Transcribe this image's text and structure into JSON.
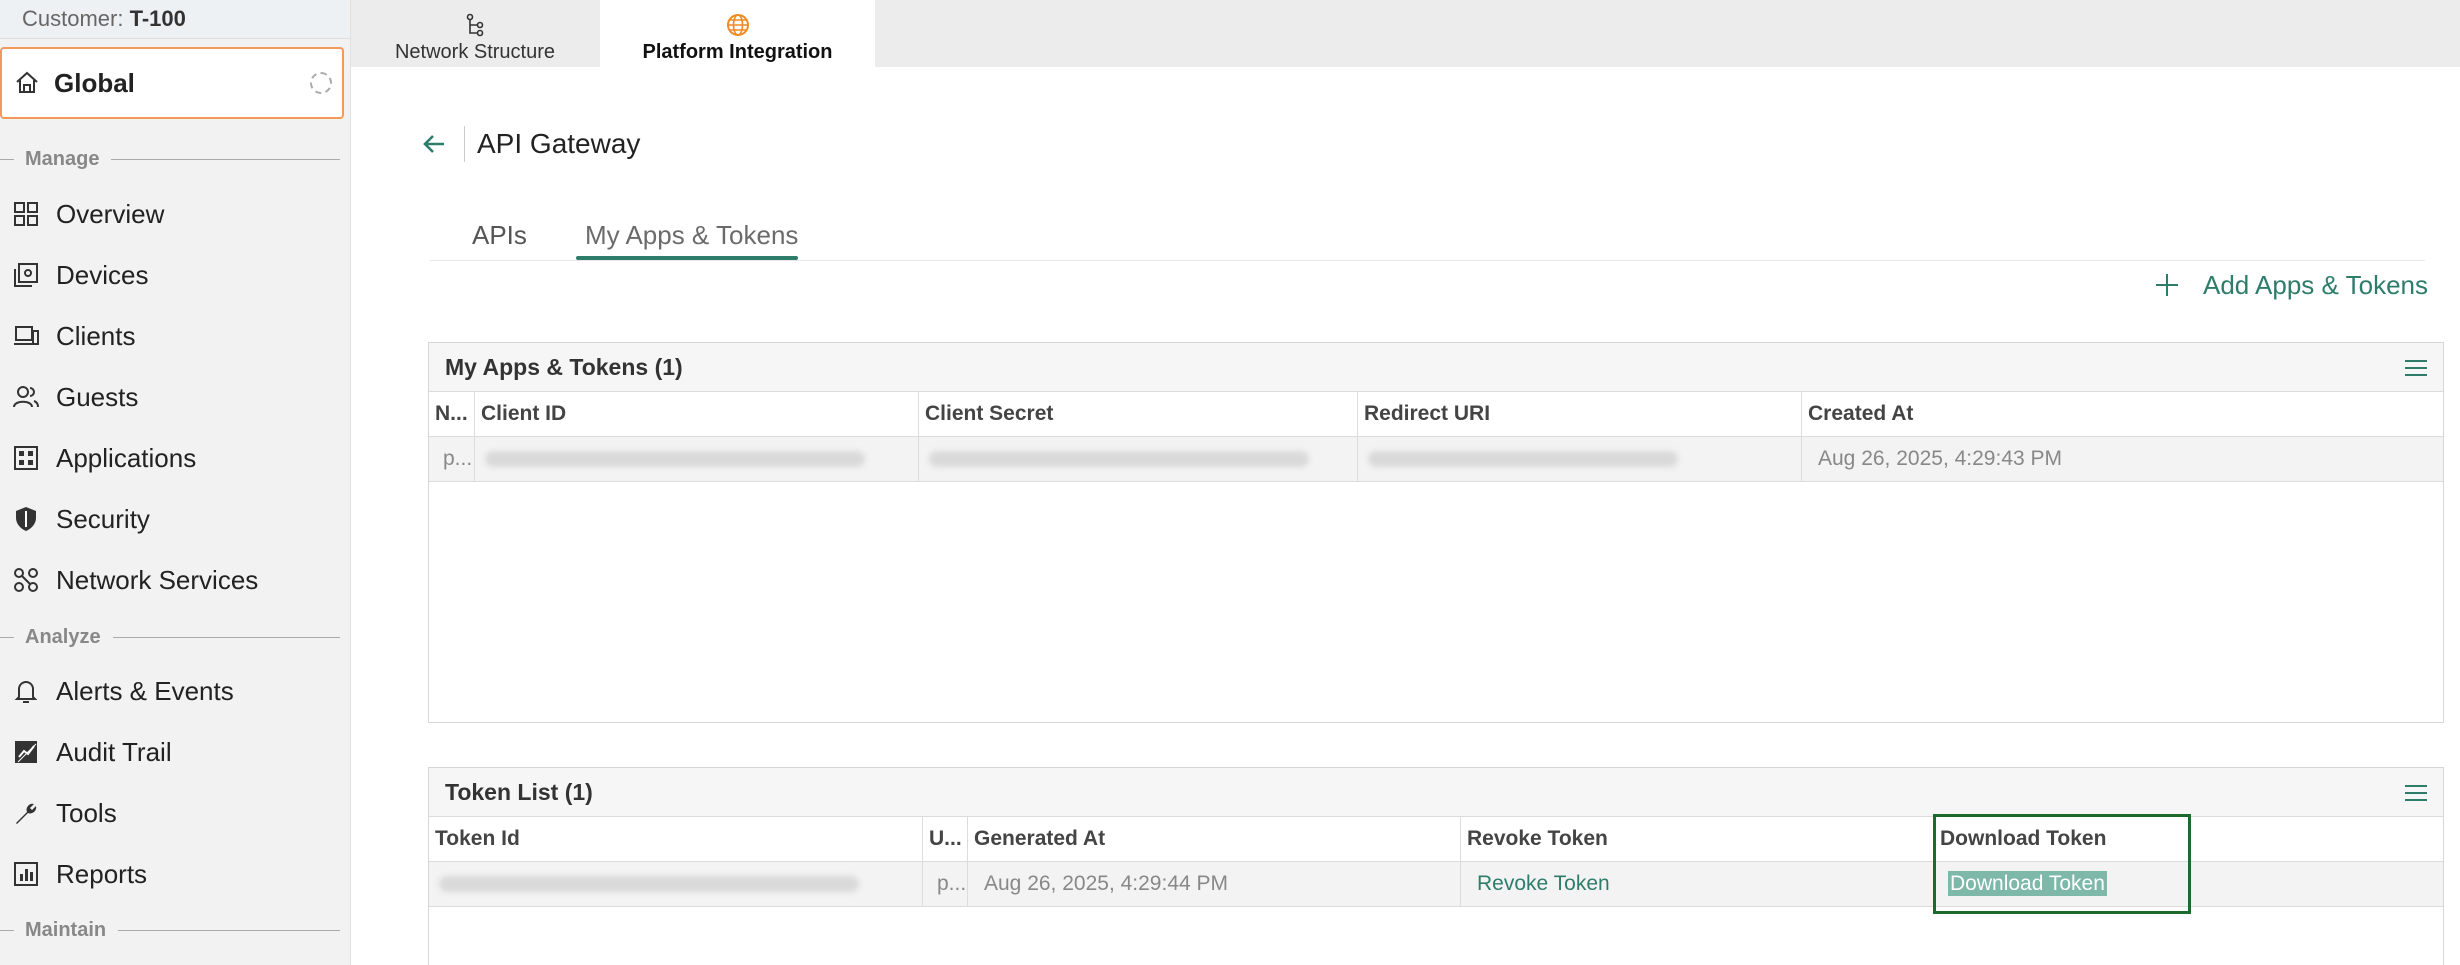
{
  "sidebar": {
    "customer_label": "Customer:",
    "customer_id": "T-100",
    "scope": "Global",
    "sections": {
      "manage": "Manage",
      "analyze": "Analyze",
      "maintain": "Maintain"
    },
    "items": [
      {
        "label": "Overview",
        "icon": "overview-grid-icon"
      },
      {
        "label": "Devices",
        "icon": "devices-icon"
      },
      {
        "label": "Clients",
        "icon": "clients-icon"
      },
      {
        "label": "Guests",
        "icon": "guests-icon"
      },
      {
        "label": "Applications",
        "icon": "applications-icon"
      },
      {
        "label": "Security",
        "icon": "shield-icon"
      },
      {
        "label": "Network Services",
        "icon": "network-services-icon"
      },
      {
        "label": "Alerts & Events",
        "icon": "bell-icon"
      },
      {
        "label": "Audit Trail",
        "icon": "audit-trail-icon"
      },
      {
        "label": "Tools",
        "icon": "wrench-icon"
      },
      {
        "label": "Reports",
        "icon": "reports-icon"
      }
    ]
  },
  "top_tabs": [
    {
      "label": "Network Structure",
      "icon": "network-structure-icon"
    },
    {
      "label": "Platform Integration",
      "icon": "globe-icon",
      "active": true
    }
  ],
  "page": {
    "title": "API Gateway",
    "tabs": [
      "APIs",
      "My Apps & Tokens"
    ],
    "active_tab": "My Apps & Tokens",
    "add_button": "Add Apps & Tokens"
  },
  "apps_table": {
    "title": "My Apps & Tokens (1)",
    "columns": [
      "N...",
      "Client ID",
      "Client Secret",
      "Redirect URI",
      "Created At"
    ],
    "rows": [
      {
        "name": "p...",
        "created_at": "Aug 26, 2025, 4:29:43 PM"
      }
    ]
  },
  "token_table": {
    "title": "Token List (1)",
    "columns": [
      "Token Id",
      "U...",
      "Generated At",
      "Revoke Token",
      "Download Token"
    ],
    "rows": [
      {
        "user": "p...",
        "generated_at": "Aug 26, 2025, 4:29:44 PM",
        "revoke": "Revoke Token",
        "download": "Download Token"
      }
    ]
  },
  "colors": {
    "accent": "#2e7d6b",
    "scope_border": "#f39a5a",
    "globe": "#f08a24",
    "focus_box": "#1c6b2c"
  }
}
